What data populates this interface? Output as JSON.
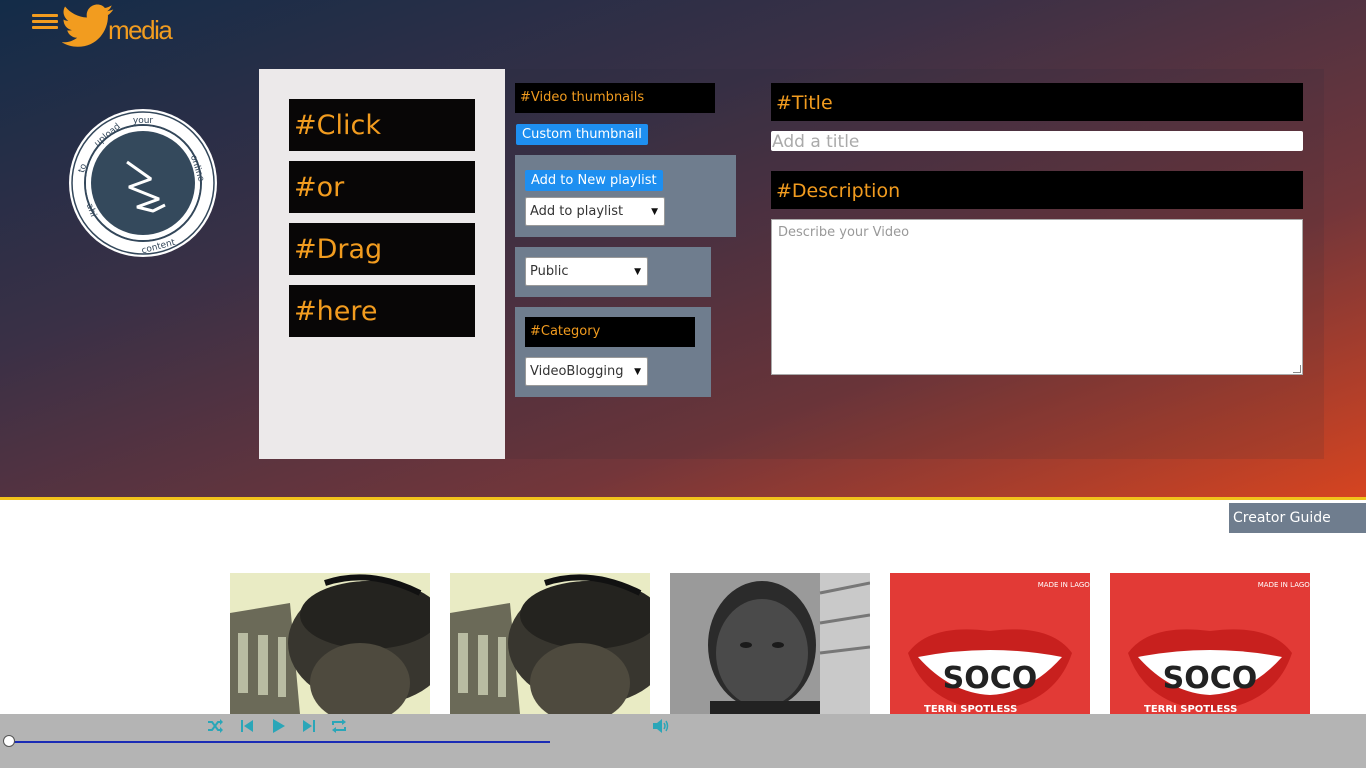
{
  "header": {
    "brand_text": "media",
    "menu_icon": "hamburger-icon",
    "logo_icon": "twitter-bird-icon"
  },
  "upload_logo": {
    "icon": "waveform-icon",
    "ring_words": [
      "to",
      "upload",
      "your",
      "online",
      "content",
      "ahi"
    ]
  },
  "dropzone": {
    "lines": [
      "#Click",
      "#or",
      "#Drag",
      "#here"
    ]
  },
  "thumbnails": {
    "label": "#Video thumbnails",
    "custom_button": "Custom thumbnail"
  },
  "playlist": {
    "add_new_button": "Add to New playlist",
    "select_value": "Add to playlist"
  },
  "visibility": {
    "select_value": "Public"
  },
  "category": {
    "label": "#Category",
    "select_value": "VideoBlogging"
  },
  "form": {
    "title_label": "#Title",
    "title_placeholder": "Add a title",
    "description_label": "#Description",
    "description_placeholder": "Describe your Video"
  },
  "creator_guide": "Creator Guide",
  "gallery": {
    "items": [
      {
        "kind": "photo-man-cap"
      },
      {
        "kind": "photo-man-cap"
      },
      {
        "kind": "photo-man-portrait"
      },
      {
        "kind": "album-art-soco",
        "badge": "MADE IN LAGOS",
        "title": "SOCO",
        "artist": "TERRI SPOTLESS"
      },
      {
        "kind": "album-art-soco",
        "badge": "MADE IN LAGOS",
        "title": "SOCO",
        "artist": "TERRI SPOTLESS"
      }
    ]
  },
  "player": {
    "icons": [
      "shuffle-icon",
      "previous-icon",
      "play-icon",
      "next-icon",
      "repeat-icon",
      "volume-icon"
    ],
    "progress": 0.0,
    "accent": "#2aa6b8"
  },
  "colors": {
    "accent_orange": "#f29c1f",
    "gradient_start": "#132c48",
    "gradient_end": "#d64420",
    "border_yellow": "#f1c21b",
    "slate": "#6f7d8e",
    "button_blue": "#1e8ff0"
  }
}
